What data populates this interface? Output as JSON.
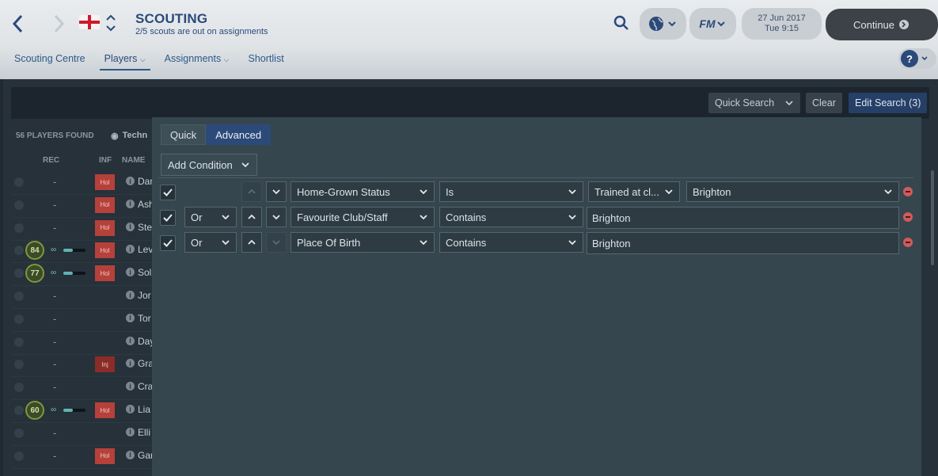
{
  "header": {
    "title": "SCOUTING",
    "subtitle": "2/5 scouts are out on assignments",
    "date": "27 Jun 2017",
    "time": "Tue 9:15",
    "continue_label": "Continue",
    "fm_label": "FM"
  },
  "tabs": [
    {
      "label": "Scouting Centre",
      "active": false
    },
    {
      "label": "Players",
      "active": true
    },
    {
      "label": "Assignments",
      "active": false
    },
    {
      "label": "Shortlist",
      "active": false
    }
  ],
  "help_label": "?",
  "search": {
    "quick_search_label": "Quick Search",
    "clear_label": "Clear",
    "edit_search_label": "Edit Search (3)"
  },
  "list": {
    "found_label": "56 PLAYERS FOUND",
    "view_label": "Techn",
    "columns": [
      "REC",
      "INF",
      "NAME"
    ],
    "rows": [
      {
        "rec": "-",
        "badge": "Hol",
        "name": "Dar"
      },
      {
        "rec": "-",
        "badge": "Hol",
        "name": "Ash"
      },
      {
        "rec": "-",
        "badge": "Hol",
        "name": "Ste"
      },
      {
        "rec": "84",
        "badge": "Hol",
        "name": "Lev"
      },
      {
        "rec": "77",
        "badge": "Hol",
        "name": "Sol"
      },
      {
        "rec": "-",
        "badge": "",
        "name": "Jor"
      },
      {
        "rec": "-",
        "badge": "",
        "name": "Tor"
      },
      {
        "rec": "-",
        "badge": "",
        "name": "Day"
      },
      {
        "rec": "-",
        "badge": "Inj",
        "name": "Gra"
      },
      {
        "rec": "-",
        "badge": "",
        "name": "Cra"
      },
      {
        "rec": "60",
        "badge": "Hol",
        "name": "Lia"
      },
      {
        "rec": "-",
        "badge": "",
        "name": "Elli"
      },
      {
        "rec": "-",
        "badge": "Hol",
        "name": "Gar"
      }
    ]
  },
  "editor": {
    "mode_quick": "Quick",
    "mode_advanced": "Advanced",
    "add_condition_label": "Add Condition",
    "conditions": [
      {
        "join": "",
        "field": "Home-Grown Status",
        "operator": "Is",
        "value_select": "Trained at cl...",
        "value": "Brighton"
      },
      {
        "join": "Or",
        "field": "Favourite Club/Staff",
        "operator": "Contains",
        "value": "Brighton"
      },
      {
        "join": "Or",
        "field": "Place Of Birth",
        "operator": "Contains",
        "value": "Brighton"
      }
    ]
  }
}
